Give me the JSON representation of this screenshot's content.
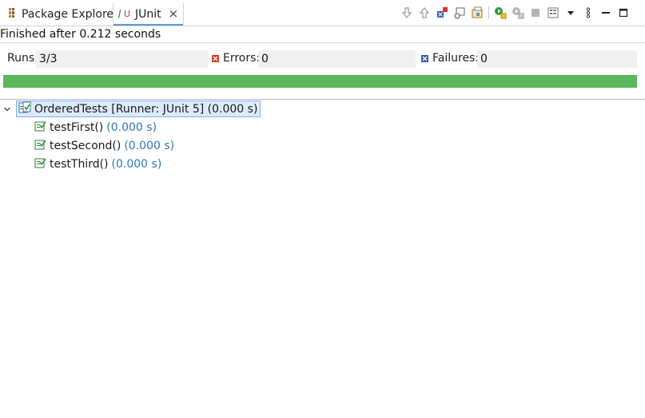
{
  "tabs": [
    {
      "label": "Package Explorer",
      "icon": "package-explorer-icon"
    },
    {
      "label": "JUnit",
      "icon": "junit-icon",
      "close": "×"
    }
  ],
  "status_text": "Finished after 0.212 seconds",
  "counters": {
    "runs_label": "Runs:",
    "runs_value": "3/3",
    "errors_label": "Errors:",
    "errors_value": "0",
    "failures_label": "Failures:",
    "failures_value": "0"
  },
  "progress": {
    "fraction": 1.0,
    "color": "#5cb85c"
  },
  "tree": {
    "root": {
      "name": "OrderedTests [Runner: JUnit 5] (0.000 s)"
    },
    "children": [
      {
        "name": "testFirst()",
        "time": "(0.000 s)"
      },
      {
        "name": "testSecond()",
        "time": "(0.000 s)"
      },
      {
        "name": "testThird()",
        "time": "(0.000 s)"
      }
    ]
  },
  "colors": {
    "accent": "#5b9bd5",
    "time": "#2b7bb9",
    "selection": "#dcebfc"
  }
}
